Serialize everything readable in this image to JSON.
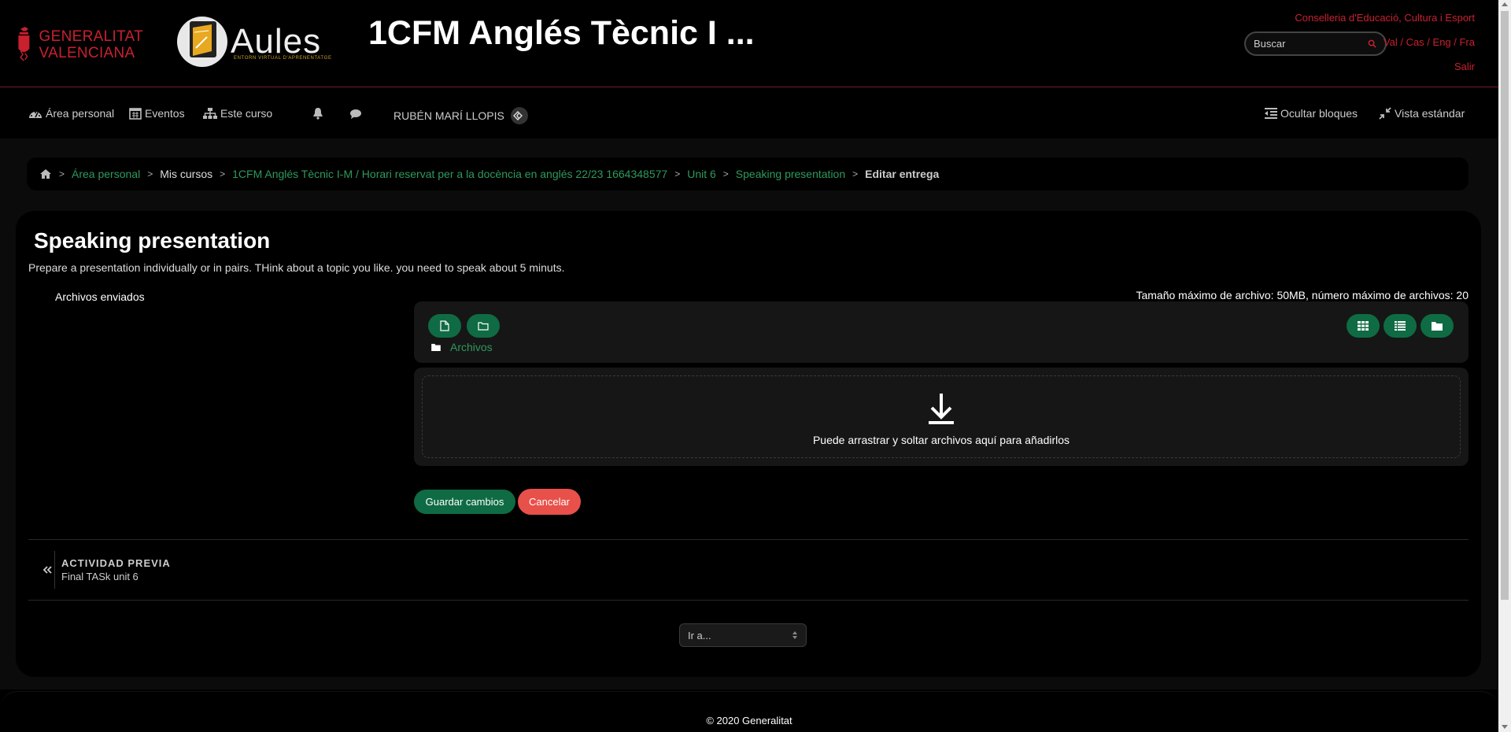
{
  "header": {
    "gv_logo_text_1": "GENERALITAT",
    "gv_logo_text_2": "VALENCIANA",
    "aules_word": "Aules",
    "aules_subtitle": "ENTORN VIRTUAL D'APRENENTATGE",
    "course_title": "1CFM Anglés Tècnic I ...",
    "conselleria": "Conselleria d'Educació, Cultura i Esport",
    "search_placeholder": "Buscar",
    "languages": "Val / Cas / Eng / Fra",
    "logout": "Salir",
    "brand_color": "#c8202f"
  },
  "nav": {
    "dashboard": "Área personal",
    "events": "Eventos",
    "this_course": "Este curso",
    "user_name": "RUBÉN MARÍ LLOPIS",
    "hide_blocks": "Ocultar bloques",
    "standard_view": "Vista estándar"
  },
  "breadcrumb": [
    "Área personal",
    "Mis cursos",
    "1CFM Anglés Tècnic I-M / Horari reservat per a la docència en anglés 22/23 1664348577",
    "Unit 6",
    "Speaking presentation",
    "Editar entrega"
  ],
  "main": {
    "page_title": "Speaking presentation",
    "intro": "Prepare a presentation individually or in pairs. THink about a topic you like. you need to speak about 5 minuts.",
    "files_label": "Archivos enviados",
    "max_size": "Tamaño máximo de archivo: 50MB, número máximo de archivos: 20",
    "folder_path": "Archivos",
    "dropzone_text": "Puede arrastrar y soltar archivos aquí para añadirlos",
    "save_label": "Guardar cambios",
    "cancel_label": "Cancelar",
    "prev_activity_label": "ACTIVIDAD PREVIA",
    "prev_activity_name": "Final TASk unit 6",
    "jump_to": "Ir a...",
    "accent_color": "#0f6b43",
    "cancel_color": "#e8504a"
  },
  "footer": {
    "copyright": "© 2020 Generalitat"
  }
}
